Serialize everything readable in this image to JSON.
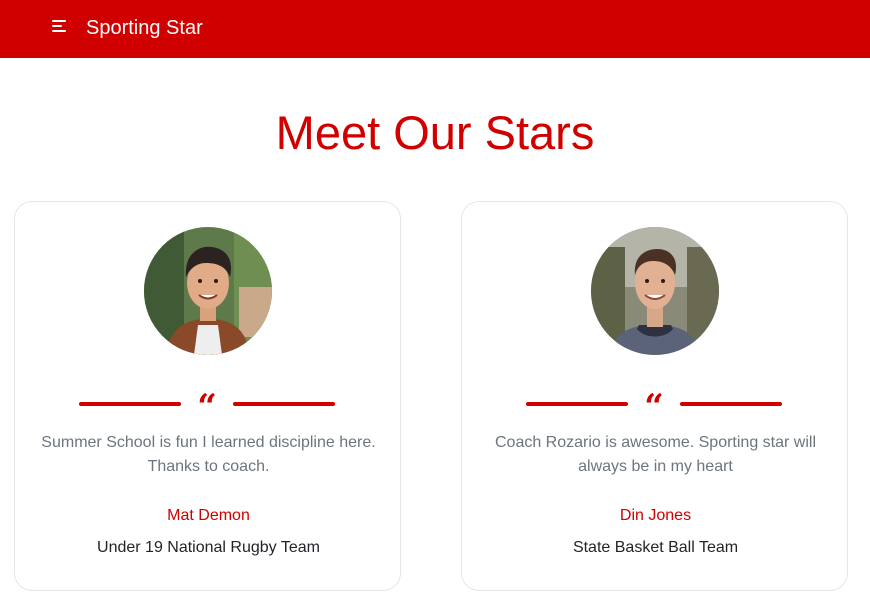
{
  "navbar": {
    "menu_icon": "menu-icon",
    "brand": "Sporting Star",
    "background": "#d10000"
  },
  "section": {
    "title": "Meet Our Stars",
    "accent_color": "#d10000"
  },
  "testimonials": [
    {
      "avatar_icon": "person-photo",
      "quote_icon": "quote-icon",
      "text": "Summer School is fun I learned discipline here. Thanks to coach.",
      "name": "Mat Demon",
      "team": "Under 19 National Rugby Team"
    },
    {
      "avatar_icon": "person-photo",
      "quote_icon": "quote-icon",
      "text": "Coach Rozario is awesome. Sporting star will always be in my heart",
      "name": "Din Jones",
      "team": "State Basket Ball Team"
    }
  ]
}
